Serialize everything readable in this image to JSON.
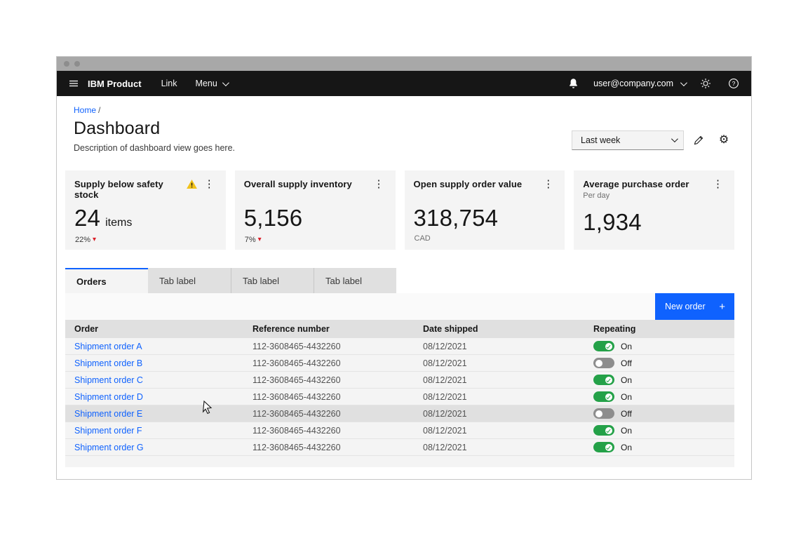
{
  "header": {
    "product_name": "IBM Product",
    "link_label": "Link",
    "menu_label": "Menu",
    "user_email": "user@company.com"
  },
  "breadcrumb": {
    "home_label": "Home",
    "separator": "/"
  },
  "page_header": {
    "title": "Dashboard",
    "description": "Description of dashboard view goes here.",
    "period_dropdown_value": "Last week"
  },
  "colors": {
    "accent_blue": "#0f62fe",
    "toggle_on_green": "#24a148",
    "delta_down_red": "#da1e28",
    "warning_yellow": "#f1c21b"
  },
  "kpi_cards": [
    {
      "title": "Supply below safety stock",
      "value": "24",
      "value_suffix": "items",
      "delta": "22%",
      "delta_direction": "down",
      "has_warning": true
    },
    {
      "title": "Overall supply inventory",
      "value": "5,156",
      "delta": "7%",
      "delta_direction": "down"
    },
    {
      "title": "Open supply order value",
      "value": "318,754",
      "footnote": "CAD"
    },
    {
      "title": "Average purchase order",
      "subtitle": "Per day",
      "value": "1,934"
    }
  ],
  "tabs": [
    {
      "label": "Orders",
      "selected": true
    },
    {
      "label": "Tab label",
      "selected": false
    },
    {
      "label": "Tab label",
      "selected": false
    },
    {
      "label": "Tab label",
      "selected": false
    }
  ],
  "toolbar": {
    "new_order_label": "New order",
    "plus": "+"
  },
  "table": {
    "columns": [
      "Order",
      "Reference number",
      "Date shipped",
      "Repeating"
    ],
    "rows": [
      {
        "order": "Shipment order A",
        "reference": "112-3608465-4432260",
        "date_shipped": "08/12/2021",
        "repeating_label": "On",
        "repeating_on": true,
        "hovered": false
      },
      {
        "order": "Shipment order B",
        "reference": "112-3608465-4432260",
        "date_shipped": "08/12/2021",
        "repeating_label": "Off",
        "repeating_on": false,
        "hovered": false
      },
      {
        "order": "Shipment order C",
        "reference": "112-3608465-4432260",
        "date_shipped": "08/12/2021",
        "repeating_label": "On",
        "repeating_on": true,
        "hovered": false
      },
      {
        "order": "Shipment order D",
        "reference": "112-3608465-4432260",
        "date_shipped": "08/12/2021",
        "repeating_label": "On",
        "repeating_on": true,
        "hovered": false
      },
      {
        "order": "Shipment order E",
        "reference": "112-3608465-4432260",
        "date_shipped": "08/12/2021",
        "repeating_label": "Off",
        "repeating_on": false,
        "hovered": true
      },
      {
        "order": "Shipment order F",
        "reference": "112-3608465-4432260",
        "date_shipped": "08/12/2021",
        "repeating_label": "On",
        "repeating_on": true,
        "hovered": false
      },
      {
        "order": "Shipment order G",
        "reference": "112-3608465-4432260",
        "date_shipped": "08/12/2021",
        "repeating_label": "On",
        "repeating_on": true,
        "hovered": false
      }
    ]
  }
}
